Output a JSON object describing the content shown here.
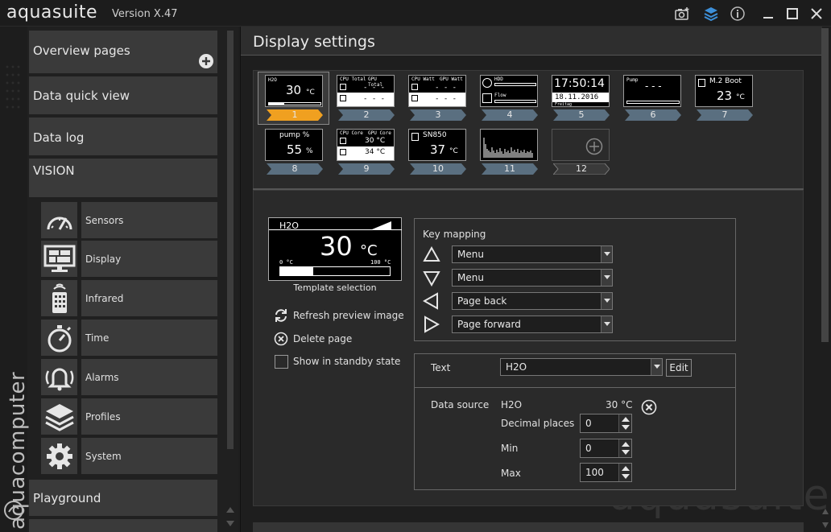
{
  "titlebar": {
    "app_name": "aquasuite",
    "version": "Version X.47",
    "icons": [
      "camera-add-icon",
      "layers-icon",
      "info-icon",
      "minimize-icon",
      "maximize-icon",
      "close-icon"
    ]
  },
  "sidebar": {
    "brand": "aquacomputer",
    "overview_pages": "Overview pages",
    "data_quick_view": "Data quick view",
    "data_log": "Data log",
    "vision": "VISION",
    "sub_items": [
      {
        "label": "Sensors",
        "icon": "gauge-icon"
      },
      {
        "label": "Display",
        "icon": "monitor-icon"
      },
      {
        "label": "Infrared",
        "icon": "remote-icon"
      },
      {
        "label": "Time",
        "icon": "stopwatch-icon"
      },
      {
        "label": "Alarms",
        "icon": "alarm-bell-icon"
      },
      {
        "label": "Profiles",
        "icon": "layers-icon"
      },
      {
        "label": "System",
        "icon": "gear-icon"
      }
    ],
    "playground": "Playground"
  },
  "main": {
    "title": "Display settings",
    "watermark": "aquasuite",
    "pages": [
      {
        "number": "1",
        "selected": true,
        "title": "H2O",
        "value": "30",
        "unit": "°C",
        "scale_min": "0 °C",
        "scale_max": "100 °C"
      },
      {
        "number": "2",
        "title_left": "CPU Total",
        "title_right": "GPU Total",
        "row1": "- - -",
        "row2": "- - -"
      },
      {
        "number": "3",
        "title_left": "CPU Watt",
        "title_right": "GPU Watt",
        "row1": "- - -",
        "row2": "- - -"
      },
      {
        "number": "4",
        "row1": "HDD",
        "row2": "Flow"
      },
      {
        "number": "5",
        "time": "17:50:14",
        "date": "18.11.2016",
        "day": "Freitag"
      },
      {
        "number": "6",
        "title": "Pump",
        "value": "- - -"
      },
      {
        "number": "7",
        "title": "M.2 Boot",
        "value": "23",
        "unit": "°C"
      },
      {
        "number": "8",
        "title": "pump %",
        "value": "55",
        "unit": "%"
      },
      {
        "number": "9",
        "title_left": "CPU Core",
        "title_right": "GPU Core",
        "row1": "30 °C",
        "row2": "34 °C"
      },
      {
        "number": "10",
        "title": "SN850",
        "value": "37",
        "unit": "°C"
      },
      {
        "number": "11"
      },
      {
        "number": "12",
        "add": true
      }
    ],
    "template": {
      "title": "H2O",
      "value": "30",
      "unit": "°C",
      "scale_min": "0 °C",
      "scale_max": "100 °C",
      "fill_fraction": 0.3,
      "label": "Template selection"
    },
    "actions": {
      "refresh": "Refresh preview image",
      "delete": "Delete page",
      "standby": "Show in standby state",
      "standby_checked": false
    },
    "key_mapping": {
      "title": "Key mapping",
      "rows": [
        {
          "key": "up-arrow-key-icon",
          "value": "Menu"
        },
        {
          "key": "down-arrow-key-icon",
          "value": "Menu"
        },
        {
          "key": "left-arrow-key-icon",
          "value": "Page back"
        },
        {
          "key": "right-arrow-key-icon",
          "value": "Page forward"
        }
      ]
    },
    "text_section": {
      "label": "Text",
      "value": "H2O",
      "edit": "Edit"
    },
    "data_source": {
      "label": "Data source",
      "name": "H2O",
      "value": "30 °C",
      "decimal_label": "Decimal places",
      "decimal_value": "0",
      "min_label": "Min",
      "min_value": "0",
      "max_label": "Max",
      "max_value": "100"
    },
    "accent_color": "#f0a020"
  }
}
